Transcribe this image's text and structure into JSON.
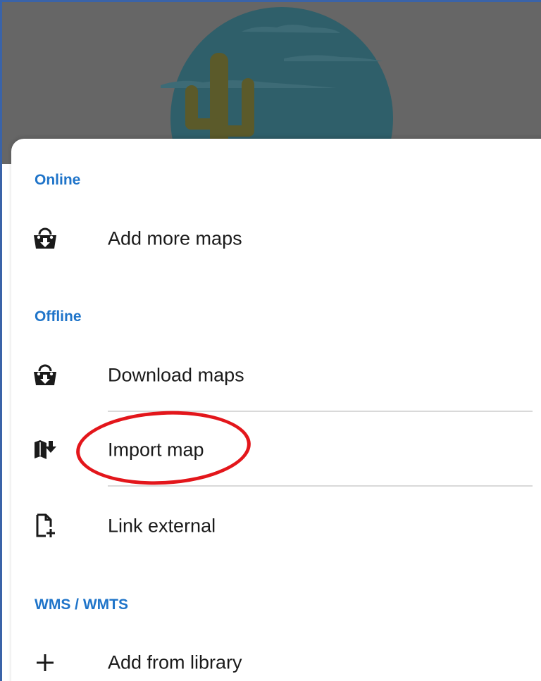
{
  "sections": {
    "online": {
      "header": "Online",
      "items": [
        {
          "label": "Add more maps",
          "icon": "shopping-bag-download-icon"
        }
      ]
    },
    "offline": {
      "header": "Offline",
      "items": [
        {
          "label": "Download maps",
          "icon": "shopping-bag-download-icon"
        },
        {
          "label": "Import map",
          "icon": "map-import-icon"
        },
        {
          "label": "Link external",
          "icon": "file-add-icon"
        }
      ]
    },
    "wms": {
      "header": "WMS / WMTS",
      "items": [
        {
          "label": "Add from library",
          "icon": "plus-icon"
        }
      ]
    }
  },
  "colors": {
    "section_header": "#1f74c9",
    "highlight": "#e3161b",
    "scrim": "#666666",
    "illustration_circle": "#2f5f6a",
    "cactus": "#5b5a2a"
  }
}
